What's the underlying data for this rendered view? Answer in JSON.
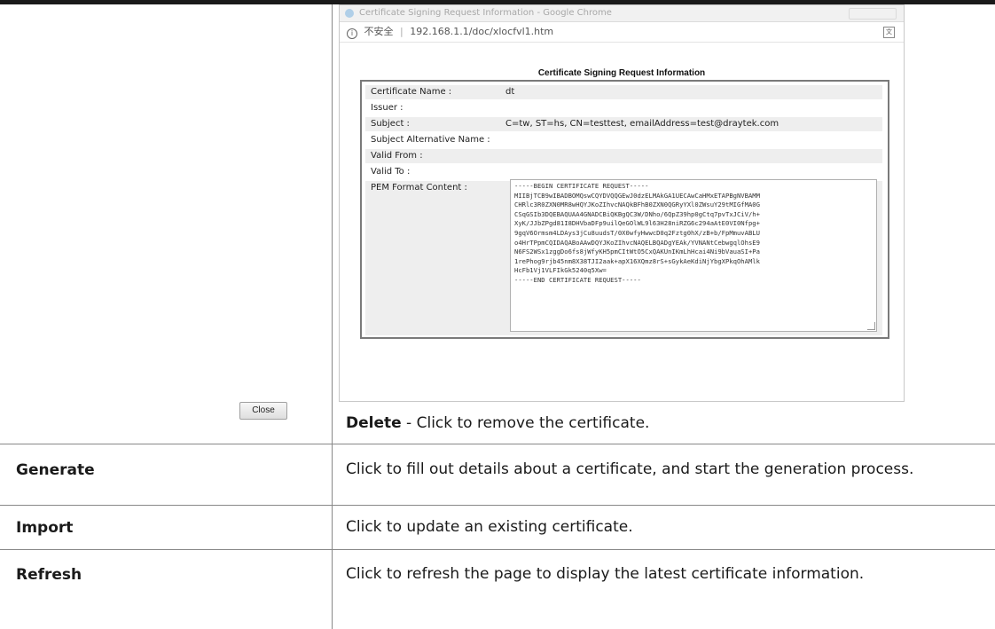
{
  "popup": {
    "window_title": "Certificate Signing Request Information - Google Chrome",
    "address_security": "不安全",
    "address_url": "192.168.1.1/doc/xlocfvl1.htm",
    "heading": "Certificate Signing Request Information",
    "fields": [
      {
        "label": "Certificate Name :",
        "value": "dt"
      },
      {
        "label": "Issuer :",
        "value": ""
      },
      {
        "label": "Subject :",
        "value": "C=tw, ST=hs, CN=testtest, emailAddress=test@draytek.com"
      },
      {
        "label": "Subject Alternative Name :",
        "value": ""
      },
      {
        "label": "Valid From :",
        "value": ""
      },
      {
        "label": "Valid To :",
        "value": ""
      }
    ],
    "pem_label": "PEM Format Content :",
    "pem_content": "-----BEGIN CERTIFICATE REQUEST-----\nMIIBjTCB9wIBADBOMQswCQYDVQQGEwJ0dzELMAkGA1UECAwCaHMxETAPBgNVBAMM\nCHRlc3R0ZXN0MR8wHQYJKoZIhvcNAQkBFhB0ZXN0QGRyYXl0ZWsuY29tMIGfMA0G\nCSqGSIb3DQEBAQUAA4GNADCBiQKBgQC3W/DNho/6QpZ39hp0gCtq7pvTxJCiV/h+\nXyK/JJbZPgd81I8DHVbaDFp9uilQeGOlWL9l63H28niRZG6c294aAtE0VI0Nfpg+\n9gqV6Ormsm4LDAys3jCu8uudsT/0X0wfyHwwcD0q2Fztg0hX/zB+b/FpMmuvABLU\no4HrTPpmCQIDAQABoAAwDQYJKoZIhvcNAQELBQADgYEAk/YVNANtCebwgqlOhsE9\nN6FS2WSx1zggDo6fs8jWfyKH5pmCItWtO5CxQAKUnIKmLhHcai4Ni9bVauaSI+Pa\n1rePhog9rjb45nm8X38TJI2aak+apX16XQmz8rS+sGykAeKdiNjYbgXPkqOhAMlk\nHcFb1Vj1VLFIkGk5240q5Xw=\n-----END CERTIFICATE REQUEST-----",
    "close_label": "Close"
  },
  "delete_note": {
    "term": "Delete",
    "text": " - Click to remove the certificate."
  },
  "rows": [
    {
      "label": "Generate",
      "desc": "Click to fill out details about a certificate, and start the generation process."
    },
    {
      "label": "Import",
      "desc": "Click to update an existing certificate."
    },
    {
      "label": "Refresh",
      "desc": "Click to refresh the page to display the latest certificate information."
    }
  ]
}
